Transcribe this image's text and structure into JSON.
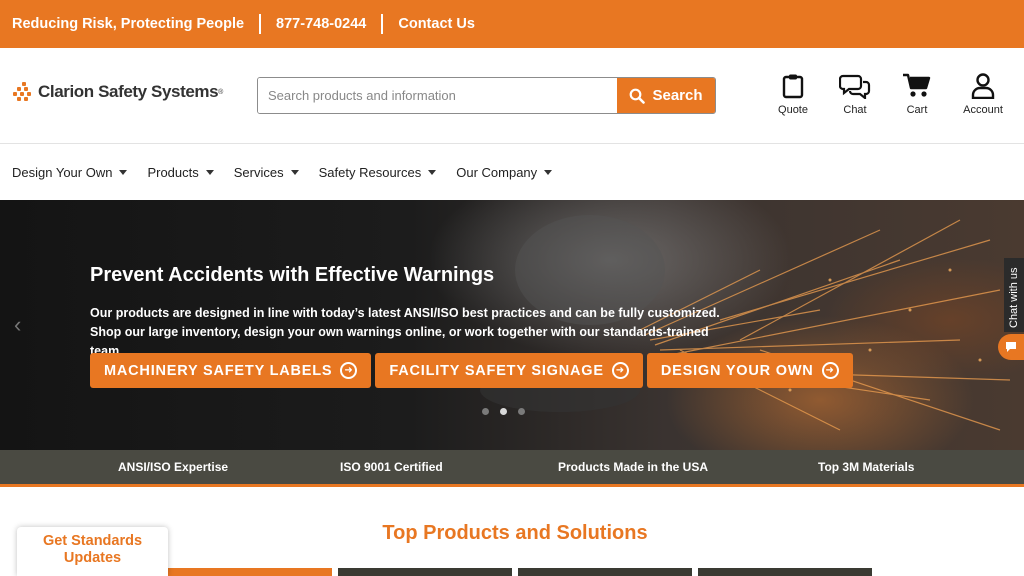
{
  "colors": {
    "accent": "#e87722",
    "dark_band": "#4a4a42",
    "text": "#222222"
  },
  "topbar": {
    "tagline": "Reducing Risk, Protecting People",
    "phone": "877-748-0244",
    "contact": "Contact Us"
  },
  "header": {
    "logo_text": "Clarion Safety Systems",
    "search_placeholder": "Search products and information",
    "search_button": "Search",
    "icons": [
      {
        "label": "Quote",
        "icon": "clipboard-icon"
      },
      {
        "label": "Chat",
        "icon": "chat-bubbles-icon"
      },
      {
        "label": "Cart",
        "icon": "cart-icon"
      },
      {
        "label": "Account",
        "icon": "user-icon"
      }
    ]
  },
  "nav": {
    "items": [
      {
        "label": "Design Your Own"
      },
      {
        "label": "Products"
      },
      {
        "label": "Services"
      },
      {
        "label": "Safety Resources"
      },
      {
        "label": "Our Company"
      }
    ]
  },
  "hero": {
    "title": "Prevent Accidents with Effective Warnings",
    "body": "Our products are designed in line with today’s latest ANSI/ISO best practices and can be fully customized. Shop our large inventory, design your own warnings online, or work together with our standards-trained team.",
    "buttons": [
      {
        "label": "MACHINERY SAFETY LABELS"
      },
      {
        "label": "FACILITY SAFETY SIGNAGE"
      },
      {
        "label": "DESIGN YOUR OWN"
      }
    ],
    "slide_count": 3,
    "active_slide": 2
  },
  "chat_widget": {
    "label": "Chat with us"
  },
  "features": [
    {
      "label": "ANSI/ISO Expertise"
    },
    {
      "label": "ISO 9001 Certified"
    },
    {
      "label": "Products Made in the USA"
    },
    {
      "label": "Top 3M Materials"
    }
  ],
  "main": {
    "section_title": "Top Products and Solutions"
  },
  "updates_tab": {
    "line1": "Get Standards",
    "line2": "Updates"
  }
}
